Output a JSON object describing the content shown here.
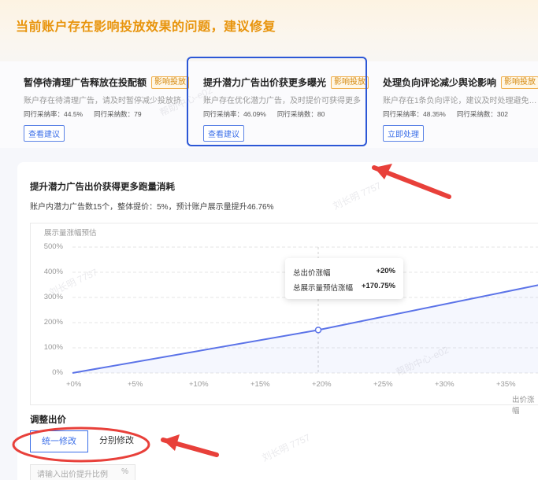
{
  "page_title": "当前账户存在影响投放效果的问题，建议修复",
  "cards": [
    {
      "title": "暂停待清理广告释放在投配额",
      "badge": "影响投放",
      "desc": "账户存在待清理广告，请及时暂停减少投放挤...",
      "stat1": "同行采纳率：44.5%",
      "stat2": "同行采纳数：79",
      "button": "查看建议"
    },
    {
      "title": "提升潜力广告出价获更多曝光",
      "badge": "影响投放",
      "desc": "账户存在优化潜力广告，及时提价可获得更多...",
      "stat1": "同行采纳率：46.09%",
      "stat2": "同行采纳数：80",
      "button": "查看建议"
    },
    {
      "title": "处理负向评论减少舆论影响",
      "badge": "影响投放",
      "desc": "账户存在1条负向评论，建议及时处理避免…",
      "stat1": "同行采纳率：48.35%",
      "stat2": "同行采纳数：302",
      "button": "立即处理"
    }
  ],
  "panel": {
    "title": "提升潜力广告出价获得更多跑量消耗",
    "desc": "账户内潜力广告数15个，整体提价：5%，预计账户展示量提升46.76%"
  },
  "chart_data": {
    "type": "line",
    "ylabel": "展示量涨幅预估",
    "xlabel": "出价涨幅",
    "y_ticks": [
      "500%",
      "400%",
      "300%",
      "200%",
      "100%",
      "0%"
    ],
    "x_ticks": [
      "+0%",
      "+5%",
      "+10%",
      "+15%",
      "+20%",
      "+25%",
      "+30%",
      "+35%"
    ],
    "x": [
      0,
      20,
      38
    ],
    "y": [
      0,
      170.75,
      350
    ],
    "ylim": [
      0,
      500
    ],
    "xlim": [
      0,
      38
    ],
    "highlight_point": {
      "x": 20,
      "y": 170.75
    },
    "line_color": "#5b73e8"
  },
  "tooltip": {
    "label1": "总出价涨幅",
    "value1": "+20%",
    "label2": "总展示量预估涨幅",
    "value2": "+170.75%"
  },
  "adjust": {
    "title": "调整出价",
    "btn_unified": "统一修改",
    "btn_separate": "分别修改",
    "input_placeholder": "请输入出价提升比例",
    "input_unit": "%"
  },
  "watermark": {
    "text1": "帮助中心-e02",
    "text2": "刘长明 7757"
  },
  "colors": {
    "accent": "#3a6ee8",
    "title_orange": "#e8940c",
    "annotation_red": "#e8403a"
  }
}
